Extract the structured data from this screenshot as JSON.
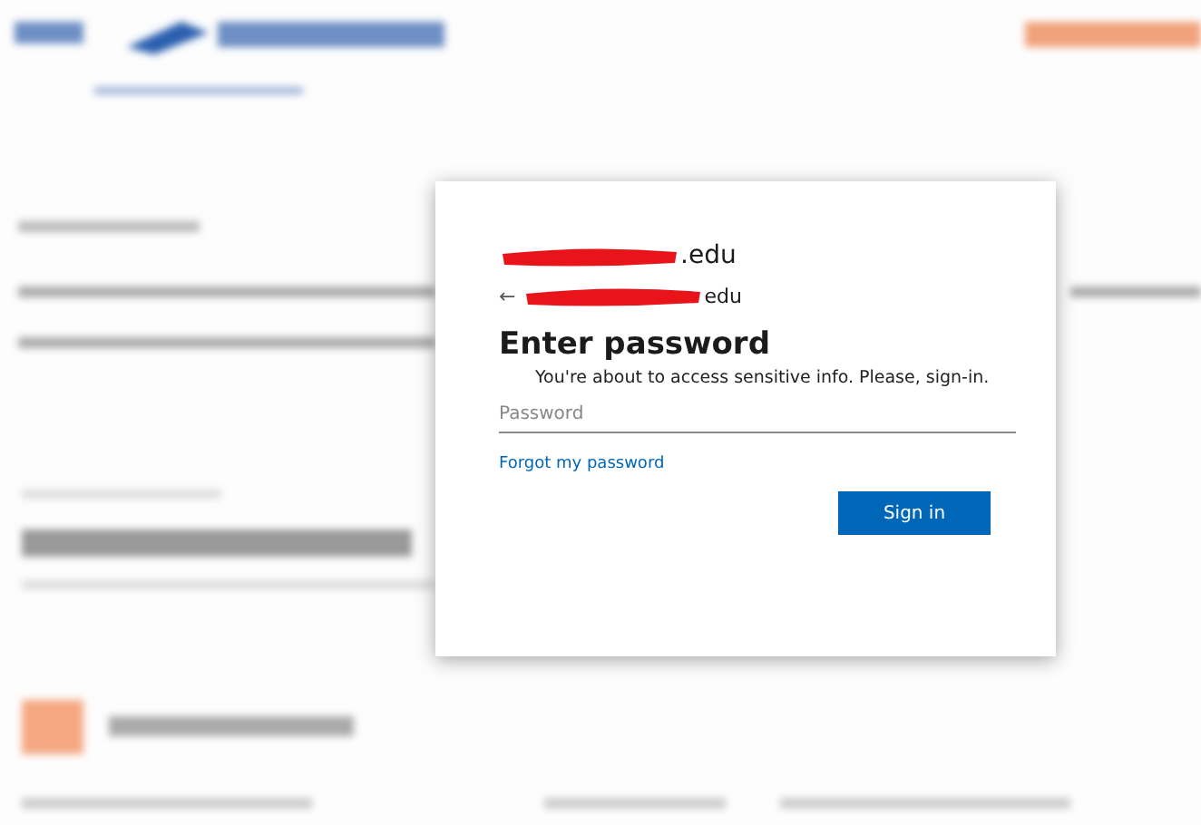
{
  "dialog": {
    "account": {
      "suffix": ".edu",
      "redacted": true
    },
    "back_account": {
      "arrow": "←",
      "suffix": "edu",
      "redacted": true
    },
    "title": "Enter password",
    "message": "You're about to access sensitive info. Please, sign-in.",
    "password": {
      "placeholder": "Password"
    },
    "forgot_link": "Forgot my password",
    "buttons": [
      {
        "label": "Sign in",
        "kind": "primary"
      }
    ]
  }
}
